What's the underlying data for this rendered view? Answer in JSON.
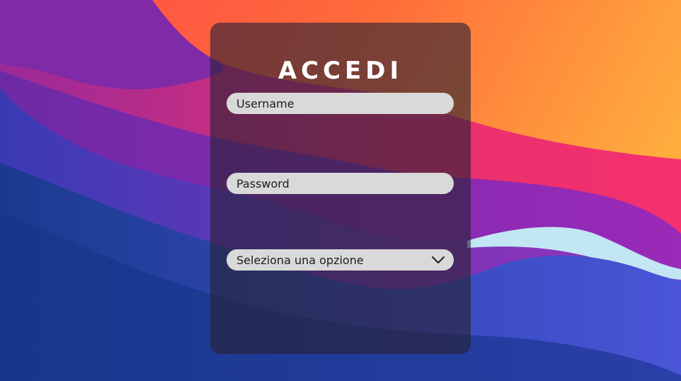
{
  "login": {
    "title": "ACCEDI",
    "username_placeholder": "Username",
    "password_placeholder": "Password",
    "select_value": "Seleziona una opzione"
  },
  "icons": {
    "select_chevron": "chevron-down-icon"
  },
  "colors": {
    "card_overlay": "rgba(40,34,52,0.62)",
    "field_background": "#d9d9d9",
    "title_color": "#ffffff",
    "bg_orange": "#ff9a3c",
    "bg_pink": "#f0306e",
    "bg_purple": "#7a2aa8",
    "bg_blue": "#1b3a8c",
    "bg_light_blue": "#bfe3f2"
  }
}
